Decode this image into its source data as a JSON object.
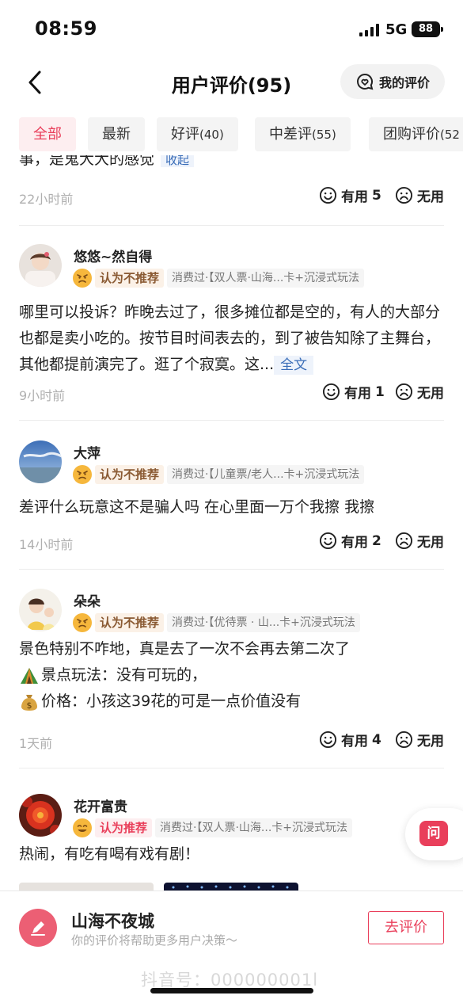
{
  "status_bar": {
    "time": "08:59",
    "network": "5G",
    "battery": "88"
  },
  "nav": {
    "title": "用户评价(95)",
    "my_review_label": "我的评价"
  },
  "tabs": [
    {
      "label": "全部",
      "count": "",
      "active": true
    },
    {
      "label": "最新",
      "count": ""
    },
    {
      "label": "好评",
      "count": "(40)"
    },
    {
      "label": "中差评",
      "count": "(55)"
    },
    {
      "label": "团购评价",
      "count": "(52"
    }
  ],
  "first_partial": {
    "text": "事，是鬼大大的感觉",
    "collapse_label": "收起",
    "time_ago": "22小时前",
    "useful_label": "有用",
    "useful_count": "5",
    "useless_label": "无用"
  },
  "reviews": [
    {
      "user": "悠悠~然自得",
      "recommend": "认为不推荐",
      "consumed": "消费过·【双人票·山海...卡+沉浸式玩法",
      "text": "哪里可以投诉？昨晚去过了，很多摊位都是空的，有人的大部分也都是卖小吃的。按节目时间表去的，到了被告知除了主舞台，其他都提前演完了。逛了个寂寞。这...",
      "fulltext_label": "全文",
      "time_ago": "9小时前",
      "useful_label": "有用",
      "useful_count": "1",
      "useless_label": "无用"
    },
    {
      "user": "大萍",
      "recommend": "认为不推荐",
      "consumed": "消费过·【儿童票/老人...卡+沉浸式玩法",
      "text": "差评什么玩意这不是骗人吗 在心里面一万个我擦 我擦",
      "time_ago": "14小时前",
      "useful_label": "有用",
      "useful_count": "2",
      "useless_label": "无用"
    },
    {
      "user": "朵朵",
      "recommend": "认为不推荐",
      "consumed": "消费过·【优待票 · 山...卡+沉浸式玩法",
      "text_lines": [
        "景色特别不咋地，真是去了一次不会再去第二次了",
        "景点玩法：没有可玩的，",
        "价格：小孩这39花的可是一点价值没有"
      ],
      "time_ago": "1天前",
      "useful_label": "有用",
      "useful_count": "4",
      "useless_label": "无用"
    },
    {
      "user": "花开富贵",
      "recommend": "认为推荐",
      "consumed": "消费过·【双人票·山海...卡+沉浸式玩法",
      "text": "热闹，有吃有喝有戏有剧！"
    }
  ],
  "ask_fab": {
    "label": "问"
  },
  "bottom": {
    "venue_name": "山海不夜城",
    "venue_sub": "你的评价将帮助更多用户决策～",
    "write_label": "去评价",
    "watermark": "抖音号：000000001l"
  },
  "colors": {
    "accent": "#e93f5b",
    "link": "#3a6db8",
    "muted": "#b0b0b0"
  }
}
